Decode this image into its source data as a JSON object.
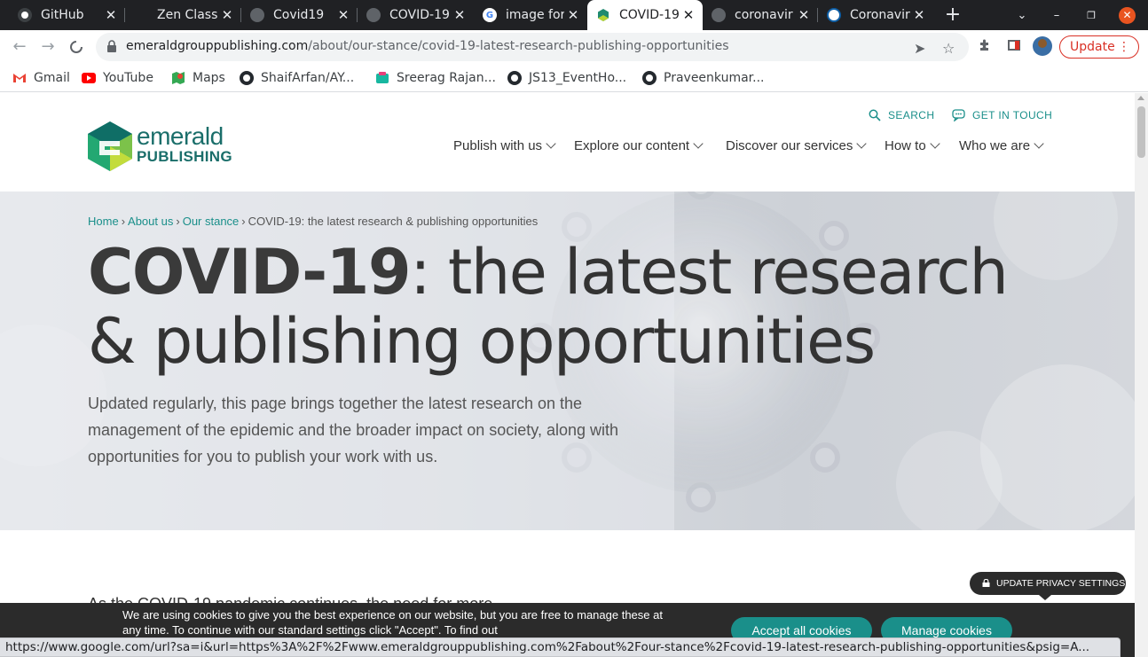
{
  "browser": {
    "tabs": [
      {
        "title": "GitHub",
        "icon": "github-icon"
      },
      {
        "title": "Zen Class",
        "icon": "blank-icon"
      },
      {
        "title": "Covid19",
        "icon": "globe-icon"
      },
      {
        "title": "COVID-19",
        "icon": "globe-icon"
      },
      {
        "title": "image for",
        "icon": "google-icon"
      },
      {
        "title": "COVID-19",
        "icon": "emerald-icon",
        "active": true
      },
      {
        "title": "coronavir",
        "icon": "globe-icon"
      },
      {
        "title": "Coronavir",
        "icon": "who-icon"
      }
    ],
    "url_host": "emeraldgrouppublishing.com",
    "url_path": "/about/our-stance/covid-19-latest-research-publishing-opportunities",
    "update_label": "Update",
    "bookmarks": [
      {
        "label": "Gmail",
        "icon": "gmail-icon"
      },
      {
        "label": "YouTube",
        "icon": "youtube-icon"
      },
      {
        "label": "Maps",
        "icon": "maps-icon"
      },
      {
        "label": "ShaifArfan/AY...",
        "icon": "github-icon"
      },
      {
        "label": "Sreerag Rajan...",
        "icon": "app-icon"
      },
      {
        "label": "JS13_EventHo...",
        "icon": "github-icon"
      },
      {
        "label": "Praveenkumar...",
        "icon": "github-icon"
      }
    ],
    "status_url": "https://www.google.com/url?sa=i&url=https%3A%2F%2Fwww.emeraldgrouppublishing.com%2Fabout%2Four-stance%2Fcovid-19-latest-research-publishing-opportunities&psig=A..."
  },
  "site": {
    "logo_top": "emerald",
    "logo_bottom": "PUBLISHING",
    "search_label": "SEARCH",
    "contact_label": "GET IN TOUCH",
    "nav": [
      "Publish with us",
      "Explore our content",
      "Discover our services",
      "How to",
      "Who we are"
    ],
    "breadcrumb": [
      "Home",
      "About us",
      "Our stance",
      "COVID-19: the latest research & publishing opportunities"
    ],
    "title_highlight": "COVID-19",
    "title_rest_line1": ": the latest research",
    "title_line2": "& publishing opportunities",
    "lead": "Updated regularly, this page brings together the latest research on the management of the epidemic and the broader impact on society, along with opportunities for you to publish your work with us.",
    "body_peek": "As the COVID-19 pandemic continues, the need for more",
    "privacy_label": "UPDATE PRIVACY SETTINGS",
    "cookie_message": "We are using cookies to give you the best experience on our website, but you are free to manage these at any time. To continue with our standard settings click \"Accept\". To find out",
    "accept_label": "Accept all cookies",
    "manage_label": "Manage cookies"
  },
  "colors": {
    "accent": "#1a8f8a",
    "chrome_dark": "#202124",
    "update_red": "#d93025"
  }
}
